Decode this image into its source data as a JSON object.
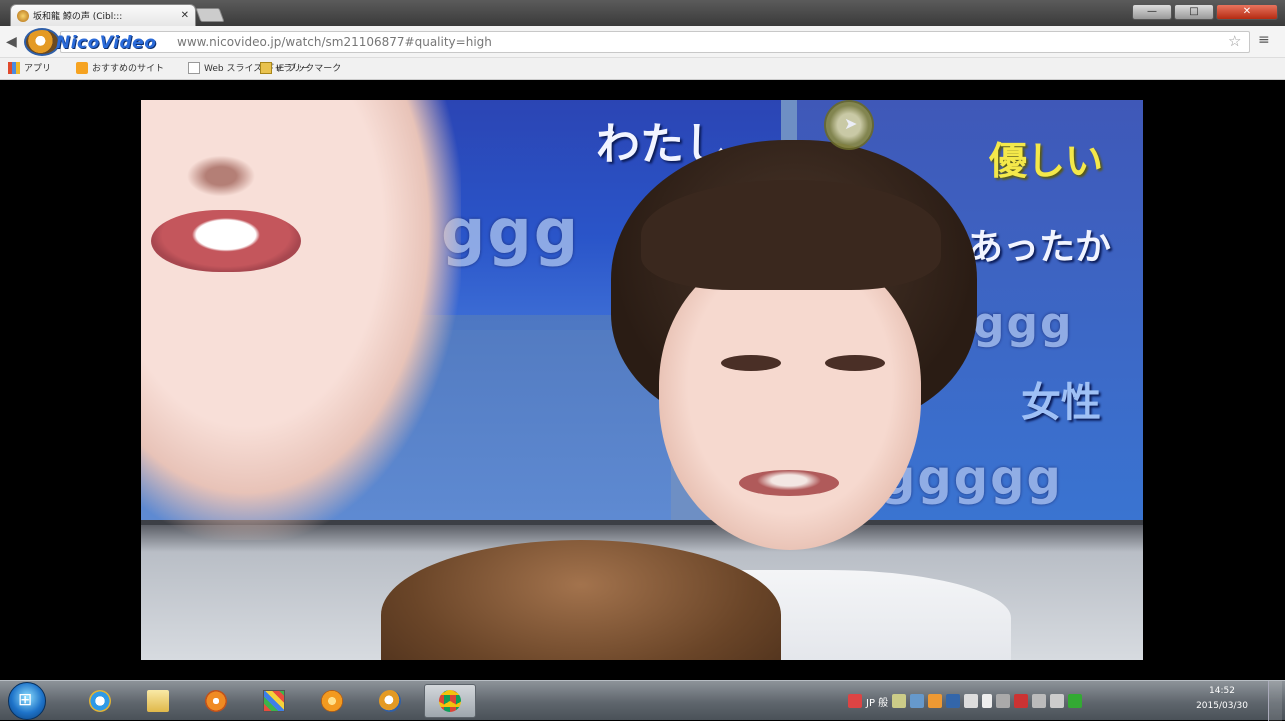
{
  "browser": {
    "tab_title": "坂和龍 鯨の声 (Cibl:::",
    "tab_close": "✕",
    "new_tab": "+",
    "window_buttons": {
      "minimize": "—",
      "maximize": "□",
      "close": "✕"
    },
    "logo_text": "NicoVideo",
    "address": "www.nicovideo.jp/watch/sm21106877#quality=high",
    "bookmarks": {
      "apps": "アプリ",
      "recommended": "おすすめのサイト",
      "webslice": "Web スライス ギャラリー",
      "ie_bookmarks": "IE ブックマーク"
    }
  },
  "video": {
    "captions": {
      "watashi": "わたし",
      "yasashii": "優しい",
      "attaka": "あったか",
      "josei": "女性"
    },
    "pattern_g1": "ggg",
    "pattern_g2": "gggggg",
    "pattern_g3": "ggg",
    "pattern_g4": "ggggg"
  },
  "taskbar": {
    "start_glyph": "⊞",
    "tray_lang": "JP  般",
    "clock_time": "14:52",
    "clock_date": "2015/03/30"
  },
  "icons": [
    "back-icon",
    "star-icon",
    "menu-icon",
    "start-orb-icon",
    "ie-icon",
    "explorer-icon",
    "media-player-icon",
    "paint-icon",
    "app-icon",
    "niconico-icon",
    "chrome-icon"
  ]
}
